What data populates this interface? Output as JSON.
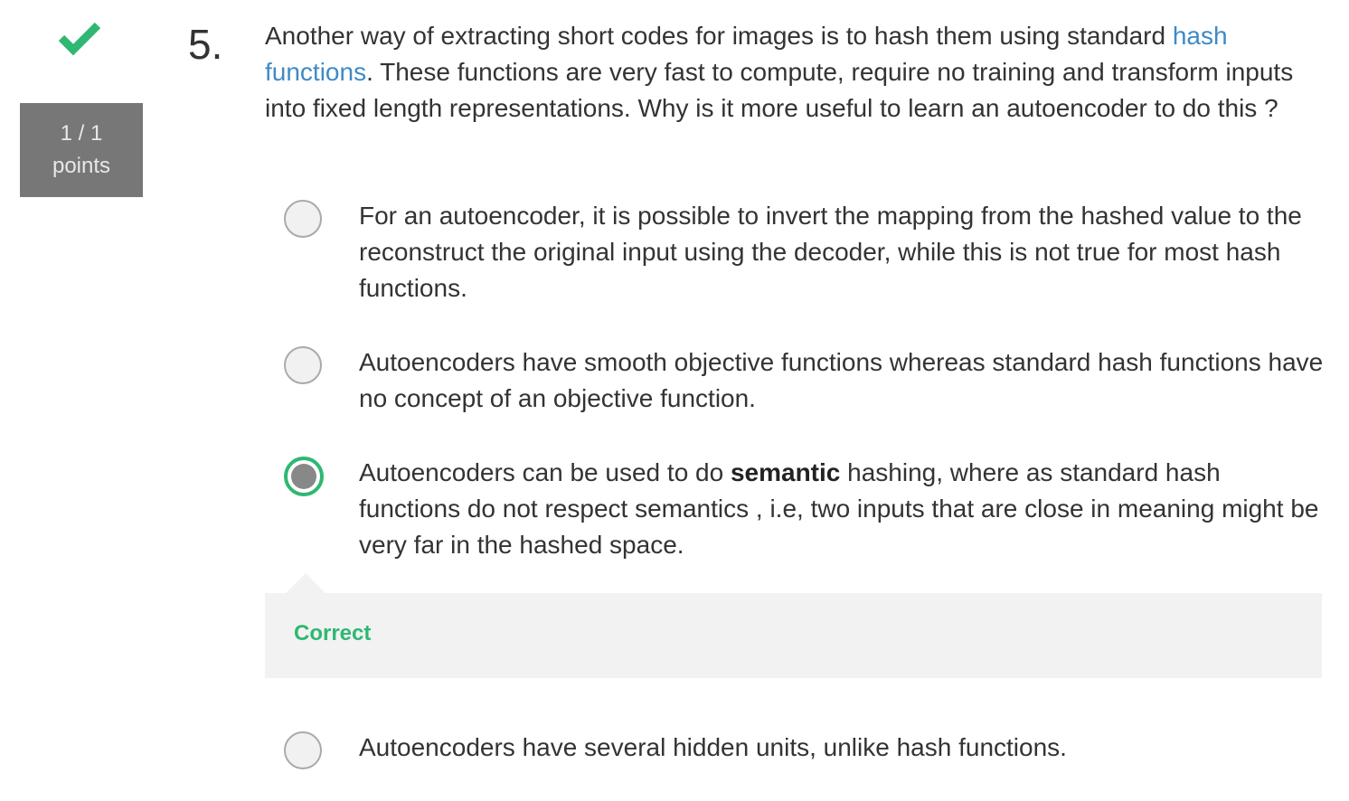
{
  "status": {
    "result_icon": "checkmark-icon",
    "result_color": "#2eb872",
    "score": "1 / 1",
    "score_unit": "points"
  },
  "question": {
    "number": "5.",
    "text_before_link": "Another way of extracting short codes for images is to hash them using standard ",
    "link_text": "hash functions",
    "text_after_link": ". These functions are very fast to compute, require no training and transform inputs into fixed length representations. Why is it more useful to learn an autoencoder to do this ?",
    "link_color": "#3e8ac6"
  },
  "options": [
    {
      "text": "For an autoencoder, it is possible to invert the mapping from the hashed value to the reconstruct the original input using the decoder, while this is not true for most hash functions.",
      "selected": false
    },
    {
      "text": "Autoencoders have smooth objective functions whereas standard hash functions have no concept of an objective function.",
      "selected": false
    },
    {
      "text_before_bold": "Autoencoders can be used to do ",
      "bold_text": "semantic",
      "text_after_bold": " hashing, where as standard hash functions do not respect semantics , i.e, two inputs that are close in meaning might be very far in the hashed space.",
      "selected": true
    },
    {
      "text": "Autoencoders have several hidden units, unlike hash functions.",
      "selected": false
    }
  ],
  "feedback": {
    "label": "Correct",
    "color": "#2eb872"
  }
}
